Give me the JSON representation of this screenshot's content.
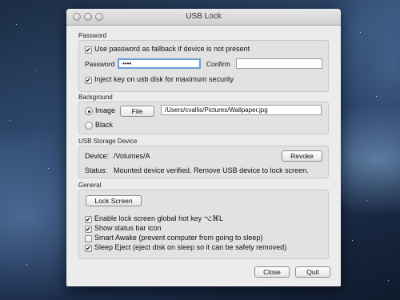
{
  "window": {
    "title": "USB Lock"
  },
  "password": {
    "section_label": "Password",
    "fallback_label": "Use password as fallback if device is not present",
    "fallback_checked": true,
    "password_label": "Password",
    "password_value": "••••",
    "confirm_label": "Confirm",
    "confirm_value": "",
    "inject_label": "Inject key on usb disk for maximum security",
    "inject_checked": true
  },
  "background": {
    "section_label": "Background",
    "image_label": "Image",
    "image_selected": true,
    "file_button": "File",
    "path_value": "/Users/cvallis/Pictures/Wallpaper.jpg",
    "black_label": "Black",
    "black_selected": false
  },
  "usb": {
    "section_label": "USB Storage Device",
    "device_label": "Device:",
    "device_value": "/Volumes/A",
    "revoke_button": "Revoke",
    "status_label": "Status:",
    "status_value": "Mounted device verified.  Remove USB device to lock screen."
  },
  "general": {
    "section_label": "General",
    "lock_button": "Lock Screen",
    "options": [
      {
        "label": "Enable lock screen global hot key ⌥⌘L",
        "checked": true
      },
      {
        "label": "Show status bar icon",
        "checked": true
      },
      {
        "label": "Smart Awake (prevent computer from going to sleep)",
        "checked": false
      },
      {
        "label": "Sleep Eject (eject disk on sleep so it can be safely removed)",
        "checked": true
      }
    ]
  },
  "footer": {
    "close_button": "Close",
    "quit_button": "Quit"
  },
  "colors": {
    "window_bg": "#ececec",
    "group_bg": "#e2e2e2",
    "focus_ring": "#6a9fd8"
  }
}
